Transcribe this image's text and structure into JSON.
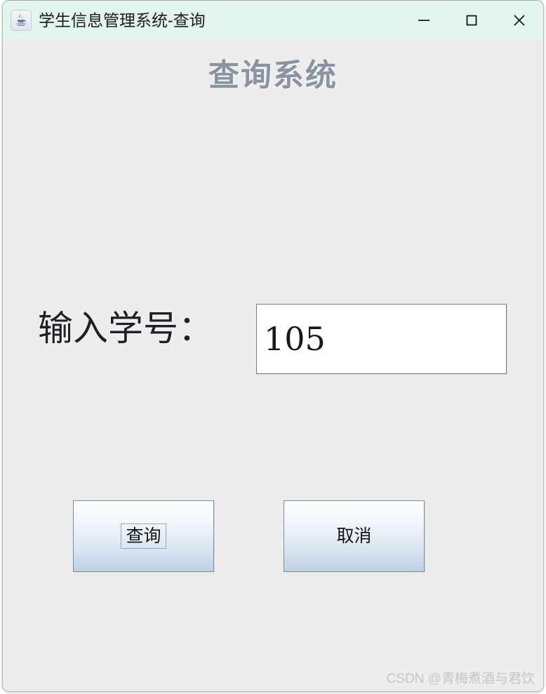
{
  "window": {
    "title": "学生信息管理系统-查询",
    "app_icon": "java-coffee-cup-icon",
    "titlebar_color": "#e4f5f0",
    "content_color": "#ededed",
    "controls": {
      "minimize": "minimize-icon",
      "maximize": "maximize-icon",
      "close": "close-icon"
    }
  },
  "main": {
    "heading": "查询系统",
    "heading_color": "#8a93a0",
    "form": {
      "label": "输入学号：",
      "input_value": "105",
      "input_placeholder": ""
    },
    "buttons": {
      "query": "查询",
      "cancel": "取消",
      "focused": "查询"
    }
  },
  "watermark": {
    "text": "CSDN @青梅煮酒与君饮",
    "color": "#c6c6c6"
  }
}
